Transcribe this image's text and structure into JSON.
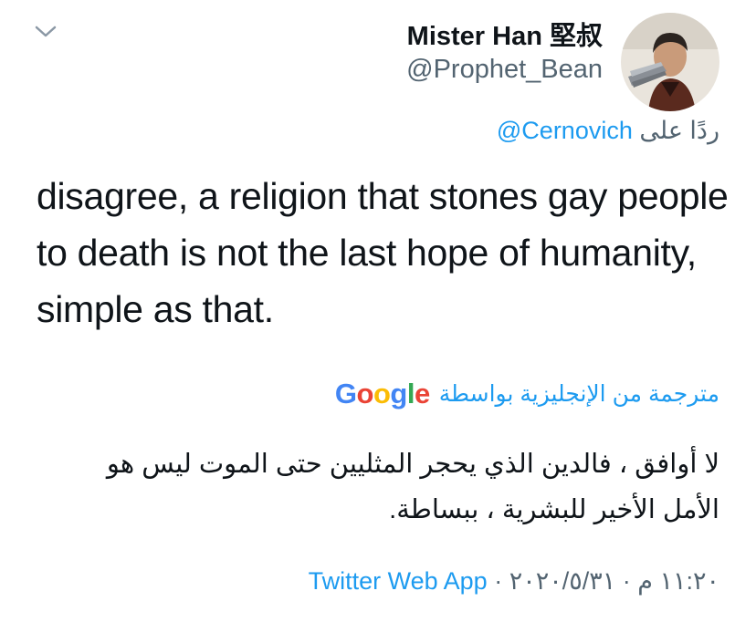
{
  "tweet": {
    "author_name": "Mister Han 堅叔",
    "author_handle": "@Prophet_Bean",
    "reply_prefix": "ردًا على",
    "reply_to": "@Cernovich",
    "text": "disagree, a religion that stones gay people to death is not the last hope of humanity, simple as that.",
    "translated_by": "مترجمة من الإنجليزية بواسطة",
    "translation_provider": "Google",
    "translation": "لا أوافق ، فالدين الذي يحجر المثليين حتى الموت ليس هو الأمل الأخير للبشرية ، ببساطة.",
    "timestamp": "١١:٢٠ م · ٢٠٢٠/٥/٣١",
    "separator": "·",
    "source": "Twitter Web App"
  },
  "icons": {
    "menu": "chevron-down-icon",
    "avatar": "avatar"
  },
  "colors": {
    "link": "#1d9bf0",
    "secondary_text": "#536471",
    "primary_text": "#0f1419",
    "google_blue": "#4285F4",
    "google_red": "#EA4335",
    "google_yellow": "#FBBC05",
    "google_green": "#34A853"
  }
}
